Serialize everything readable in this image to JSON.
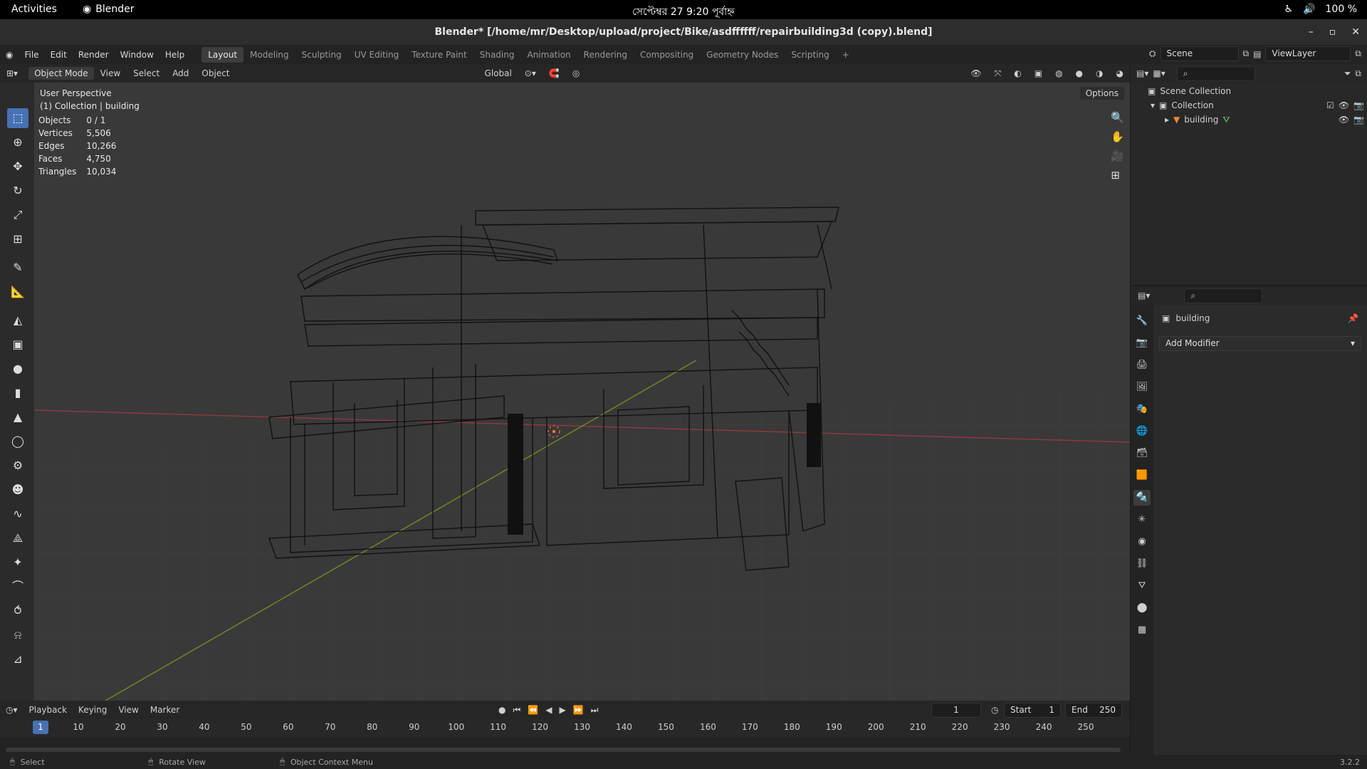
{
  "system": {
    "activities": "Activities",
    "app_name": "Blender",
    "clock": "সেপ্টেম্বর 27  9:20 পূর্বাহ্ন",
    "battery": "100 %"
  },
  "window": {
    "title": "Blender* [/home/mr/Desktop/upload/project/Bike/asdffffff/repairbuilding3d (copy).blend]"
  },
  "menu": {
    "items": [
      "File",
      "Edit",
      "Render",
      "Window",
      "Help"
    ],
    "workspaces": [
      "Layout",
      "Modeling",
      "Sculpting",
      "UV Editing",
      "Texture Paint",
      "Shading",
      "Animation",
      "Rendering",
      "Compositing",
      "Geometry Nodes",
      "Scripting"
    ],
    "active_workspace": "Layout",
    "scene": "Scene",
    "view_layer": "ViewLayer"
  },
  "viewport_header": {
    "mode": "Object Mode",
    "menus": [
      "View",
      "Select",
      "Add",
      "Object"
    ],
    "orientation": "Global",
    "options": "Options"
  },
  "viewport": {
    "perspective": "User Perspective",
    "collection_line": "(1) Collection | building",
    "stats": [
      {
        "label": "Objects",
        "value": "0 / 1"
      },
      {
        "label": "Vertices",
        "value": "5,506"
      },
      {
        "label": "Edges",
        "value": "10,266"
      },
      {
        "label": "Faces",
        "value": "4,750"
      },
      {
        "label": "Triangles",
        "value": "10,034"
      }
    ]
  },
  "outliner": {
    "scene_collection": "Scene Collection",
    "collection": "Collection",
    "object": "building"
  },
  "properties": {
    "object_name": "building",
    "add_modifier": "Add Modifier"
  },
  "timeline": {
    "menus": [
      "Playback",
      "Keying",
      "View",
      "Marker"
    ],
    "current_frame": "1",
    "start_label": "Start",
    "start": "1",
    "end_label": "End",
    "end": "250",
    "ticks": [
      "1",
      "10",
      "20",
      "30",
      "40",
      "50",
      "60",
      "70",
      "80",
      "90",
      "100",
      "110",
      "120",
      "130",
      "140",
      "150",
      "160",
      "170",
      "180",
      "190",
      "200",
      "210",
      "220",
      "230",
      "240",
      "250"
    ]
  },
  "status": {
    "select": "Select",
    "rotate": "Rotate View",
    "context": "Object Context Menu",
    "version": "3.2.2"
  }
}
